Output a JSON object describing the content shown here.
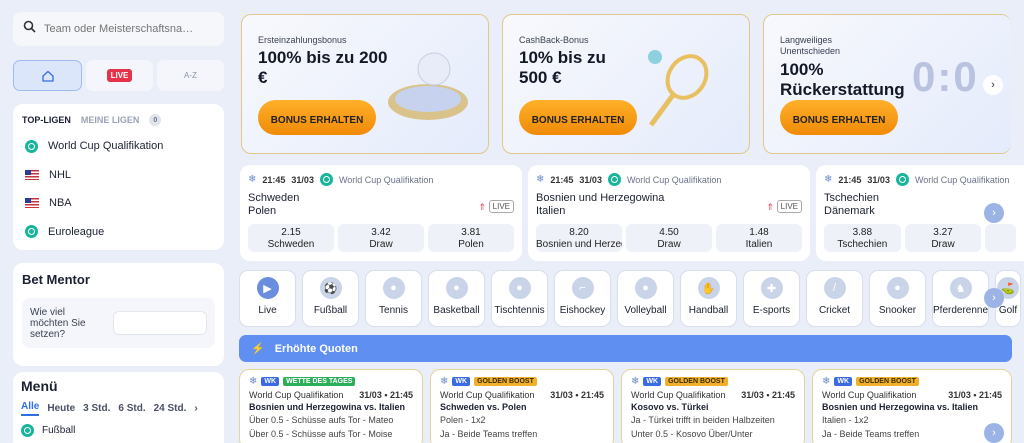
{
  "search": {
    "placeholder": "Team oder Meisterschaftsna…"
  },
  "top_tabs": {
    "live": "LIVE",
    "az": "A-Z"
  },
  "leagues": {
    "title": "TOP-LIGEN",
    "my": "MEINE LIGEN",
    "my_count": "0",
    "items": [
      {
        "label": "World Cup Qualifikation"
      },
      {
        "label": "NHL"
      },
      {
        "label": "NBA"
      },
      {
        "label": "Euroleague"
      }
    ]
  },
  "mentor": {
    "title": "Bet Mentor",
    "question": "Wie viel möchten Sie setzen?"
  },
  "menu": {
    "title": "Menü",
    "tabs": [
      "Alle",
      "Heute",
      "3 Std.",
      "6 Std.",
      "24 Std."
    ],
    "row": "Fußball"
  },
  "promos": [
    {
      "sub": "Ersteinzahlungsbonus",
      "big": "100% bis zu 200 €",
      "button": "BONUS ERHALTEN"
    },
    {
      "sub": "CashBack-Bonus",
      "big": "10% bis zu 500 €",
      "button": "BONUS ERHALTEN"
    },
    {
      "sub": "Langweiliges Unentschieden",
      "big": "100% Rückerstattung",
      "button": "BONUS ERHALTEN",
      "score": "0:0"
    }
  ],
  "matches": [
    {
      "time": "21:45",
      "date": "31/03",
      "league": "World Cup Qualifikation",
      "home": "Schweden",
      "away": "Polen",
      "live": "LIVE",
      "odds": [
        {
          "v": "2.15",
          "l": "Schweden"
        },
        {
          "v": "3.42",
          "l": "Draw"
        },
        {
          "v": "3.81",
          "l": "Polen"
        }
      ]
    },
    {
      "time": "21:45",
      "date": "31/03",
      "league": "World Cup Qualifikation",
      "home": "Bosnien und Herzegowina",
      "away": "Italien",
      "live": "LIVE",
      "odds": [
        {
          "v": "8.20",
          "l": "Bosnien und Herzegowina"
        },
        {
          "v": "4.50",
          "l": "Draw"
        },
        {
          "v": "1.48",
          "l": "Italien"
        }
      ]
    },
    {
      "time": "21:45",
      "date": "31/03",
      "league": "World Cup Qualifikation",
      "home": "Tschechien",
      "away": "Dänemark",
      "odds": [
        {
          "v": "3.88",
          "l": "Tschechien"
        },
        {
          "v": "3.27",
          "l": "Draw"
        },
        {
          "v": "",
          "l": ""
        }
      ]
    }
  ],
  "sports": [
    "Live",
    "Fußball",
    "Tennis",
    "Basketball",
    "Tischtennis",
    "Eishockey",
    "Volleyball",
    "Handball",
    "E-sports",
    "Cricket",
    "Snooker",
    "Pferderennen",
    "Golf"
  ],
  "boost": {
    "title": "Erhöhte Quoten"
  },
  "boost_cards": [
    {
      "wk": "WK",
      "tag": "WETTE DES TAGES",
      "tag_color": "green",
      "league": "World Cup Qualifikation",
      "date": "31/03 • 21:45",
      "match": "Bosnien und Herzegowina vs. Italien",
      "sel1": "Über 0.5 - Schüsse aufs Tor - Mateo",
      "sel2": "Über 0.5 - Schüsse aufs Tor - Moise"
    },
    {
      "wk": "WK",
      "tag": "GOLDEN BOOST",
      "tag_color": "gold",
      "league": "World Cup Qualifikation",
      "date": "31/03 • 21:45",
      "match": "Schweden vs. Polen",
      "sel1": "Polen - 1x2",
      "sel2": "Ja - Beide Teams treffen"
    },
    {
      "wk": "WK",
      "tag": "GOLDEN BOOST",
      "tag_color": "gold",
      "league": "World Cup Qualifikation",
      "date": "31/03 • 21:45",
      "match": "Kosovo vs. Türkei",
      "sel1": "Ja - Türkei trifft in beiden Halbzeiten",
      "sel2": "Unter 0.5 - Kosovo Über/Unter"
    },
    {
      "wk": "WK",
      "tag": "GOLDEN BOOST",
      "tag_color": "gold",
      "league": "World Cup Qualifikation",
      "date": "31/03 • 21:45",
      "match": "Bosnien und Herzegowina vs. Italien",
      "sel1": "Italien - 1x2",
      "sel2": "Ja - Beide Teams treffen"
    }
  ]
}
